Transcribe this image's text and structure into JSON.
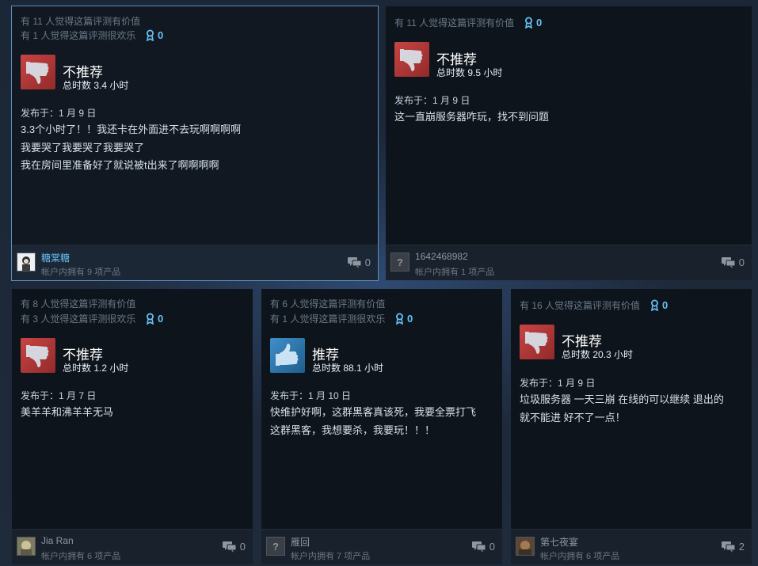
{
  "reviews": [
    {
      "helpful": "有 11 人觉得这篇评测有价值",
      "funny": "有 1 人觉得这篇评测很欢乐",
      "awards": "0",
      "verdict": "不推荐",
      "recommended": false,
      "hours": "总时数 3.4 小时",
      "posted": "发布于：1 月 9 日",
      "lines": [
        "3.3个小时了！！我还卡在外面进不去玩啊啊啊啊",
        "我要哭了我要哭了我要哭了",
        "我在房间里准备好了就说被t出来了啊啊啊啊"
      ],
      "username": "糖棠糖",
      "owned": "帐户内拥有 9 项产品",
      "comments": "0"
    },
    {
      "helpful": "有 11 人觉得这篇评测有价值",
      "awards": "0",
      "verdict": "不推荐",
      "recommended": false,
      "hours": "总时数 9.5 小时",
      "posted": "发布于：1 月 9 日",
      "lines": [
        "这一直崩服务器咋玩，找不到问题"
      ],
      "username": "1642468982",
      "owned": "帐户内拥有 1 项产品",
      "comments": "0"
    },
    {
      "helpful": "有 8 人觉得这篇评测有价值",
      "funny": "有 3 人觉得这篇评测很欢乐",
      "awards": "0",
      "verdict": "不推荐",
      "recommended": false,
      "hours": "总时数 1.2 小时",
      "posted": "发布于：1 月 7 日",
      "lines": [
        "美羊羊和沸羊羊无马"
      ],
      "username": "Jia Ran",
      "owned": "帐户内拥有 6 项产品",
      "comments": "0"
    },
    {
      "helpful": "有 6 人觉得这篇评测有价值",
      "funny": "有 1 人觉得这篇评测很欢乐",
      "awards": "0",
      "verdict": "推荐",
      "recommended": true,
      "hours": "总时数 88.1 小时",
      "posted": "发布于：1 月 10 日",
      "lines": [
        "快维护好啊，这群黑客真该死，我要全票打飞",
        "这群黑客，我想要杀，我要玩！！！"
      ],
      "username": "雁回",
      "owned": "帐户内拥有 7 项产品",
      "comments": "0"
    },
    {
      "helpful": "有 16 人觉得这篇评测有价值",
      "awards": "0",
      "verdict": "不推荐",
      "recommended": false,
      "hours": "总时数 20.3 小时",
      "posted": "发布于：1 月 9 日",
      "lines": [
        "垃圾服务器 一天三崩 在线的可以继续 退出的",
        "就不能进 好不了一点！"
      ],
      "username": "第七夜宴",
      "owned": "帐户内拥有 6 项产品",
      "comments": "2"
    }
  ],
  "icons": {
    "award": "award-ribbon-icon",
    "thumb_down": "thumbs-down-icon",
    "thumb_up": "thumbs-up-icon",
    "comment": "comment-bubble-icon",
    "unknown_avatar_glyph": "?"
  },
  "colors": {
    "accent": "#66c0f4",
    "not_recommended": "#c84444",
    "recommended": "#3f8fc8"
  }
}
